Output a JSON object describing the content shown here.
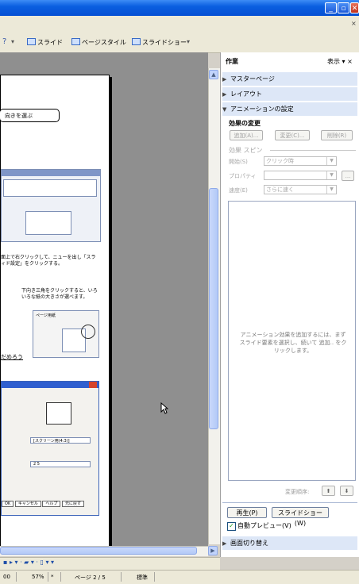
{
  "toolbar": {
    "slide_label": "スライド",
    "page_style_label": "ページスタイル",
    "slideshow_label": "スライドショー"
  },
  "slide": {
    "callout_text": "向きを選ぶ",
    "para1": "面上で右クリックして、ニューを出し「スラ\nィド設定」をクリックする。",
    "para2": "下向き三角をクリックすると、いろ\nいろな紙の大きさが選べます。",
    "link_text": "だめろう",
    "dialog_combo_value": "[スクリーン用(4:3)]",
    "dialog_field_value": "2 5",
    "dialog_buttons": [
      "OK",
      "キャンセル",
      "ヘルプ",
      "元に戻す"
    ],
    "mini_tabs": [
      "ページ",
      "用紙"
    ]
  },
  "task_pane": {
    "title": "作業",
    "view_label": "表示",
    "sections": {
      "master_pages": "マスターページ",
      "layout": "レイアウト",
      "animation": "アニメーションの設定",
      "transition": "画面切り替え"
    },
    "effect_change_header": "効果の変更",
    "add_button": "追加(A)...",
    "change_button": "変更(C)...",
    "delete_button": "削除(R)",
    "speed_group": "効果 スピン",
    "start_label": "開始(S)",
    "start_value": "クリック時",
    "property_label": "プロパティ",
    "speed_label": "速度(E)",
    "speed_value": "さらに速く",
    "list_hint": "アニメーション効果を追加するには、まず\nスライド要素を選択し、続いて 追加.. をク\nリックします。",
    "reorder_label": "変更順序:",
    "play_button": "再生(P)",
    "slideshow_button": "スライドショー(W)",
    "auto_preview_label": "自動プレビュー(V)",
    "auto_preview_checked": true
  },
  "status": {
    "pos": "00",
    "zoom": "57%",
    "page": "ページ 2 / 5",
    "layout": "標準"
  }
}
